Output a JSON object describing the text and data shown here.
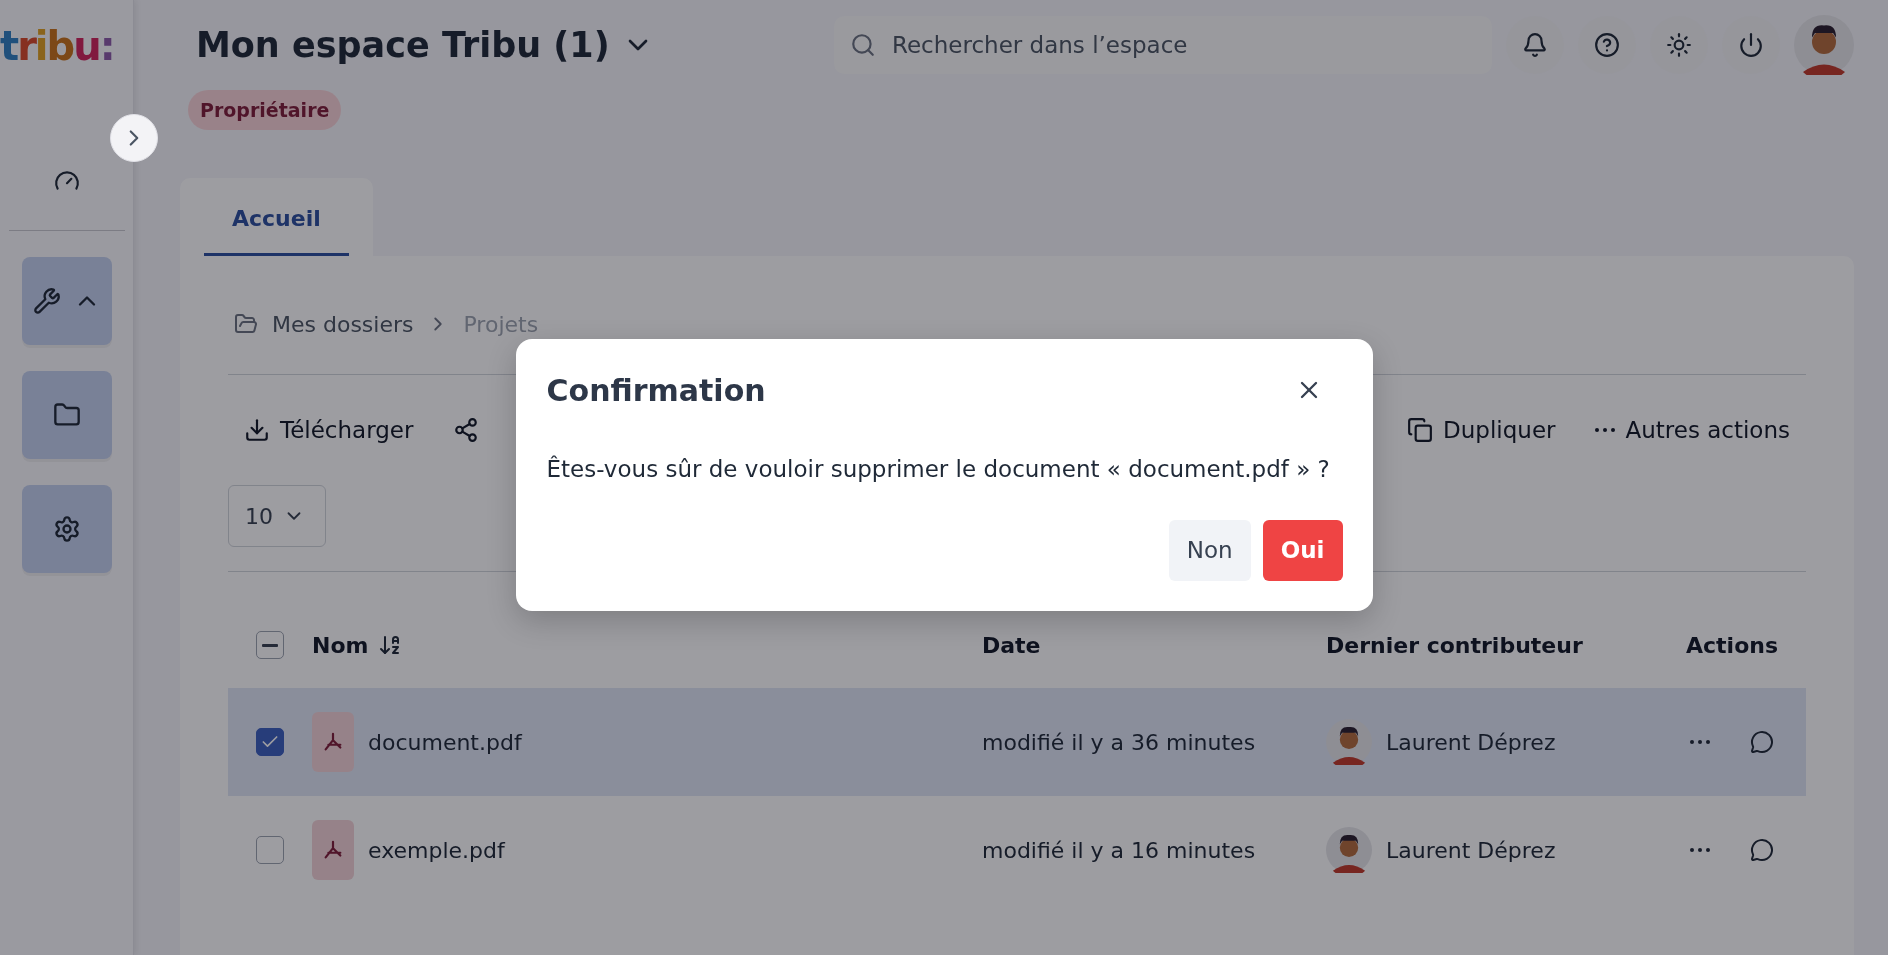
{
  "app": {
    "logo": "tribu:"
  },
  "header": {
    "title": "Mon espace Tribu (1)",
    "role_badge": "Propriétaire",
    "search": {
      "placeholder": "Rechercher dans l’espace"
    }
  },
  "sidebar": {
    "tools_expanded": true
  },
  "tabs": [
    {
      "label": "Accueil",
      "selected": true
    }
  ],
  "breadcrumb": [
    "Mes dossiers",
    "Projets"
  ],
  "toolbar": [
    {
      "kind": "download",
      "label": "Télécharger"
    },
    {
      "kind": "share"
    },
    {
      "kind": "duplicate",
      "label": "Dupliquer"
    },
    {
      "kind": "more",
      "label": "Autres actions"
    }
  ],
  "page_size": "10",
  "table": {
    "select_all": {
      "indeterminate": true
    },
    "columns": [
      "Nom",
      "Date",
      "Dernier contributeur",
      "Actions"
    ],
    "rows": [
      {
        "name": "document.pdf",
        "date": "modifié il y a 36 minutes",
        "contributor": "Laurent Déprez",
        "selected": true
      },
      {
        "name": "exemple.pdf",
        "date": "modifié il y a 16 minutes",
        "contributor": "Laurent Déprez",
        "selected": false
      }
    ]
  },
  "modal": {
    "title": "Confirmation",
    "message": "Êtes-vous sûr de vouloir supprimer le document « document.pdf » ?",
    "buttons": [
      {
        "kind": "secondary",
        "label": "Non"
      },
      {
        "kind": "danger",
        "label": "Oui"
      }
    ]
  }
}
